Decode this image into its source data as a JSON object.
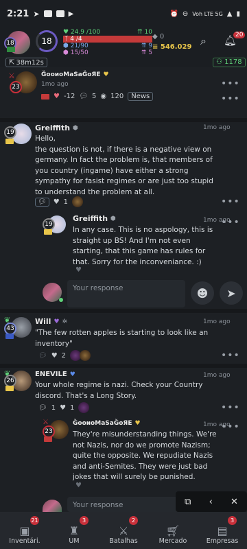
{
  "status_bar": {
    "time": "2:21",
    "network": "Voh LTE 5G"
  },
  "top_bar": {
    "level": "18",
    "avatar_level": "18",
    "energy": "24.9 /100",
    "energy_gain": "10",
    "health": "4 /4",
    "stat_a": "21/90",
    "stat_a_gain": "9",
    "stat_b": "15/50",
    "stat_b_gain": "5",
    "gold": "0",
    "money": "546.029",
    "notification_count": "20"
  },
  "sub_bar": {
    "timer": "38m12s",
    "online": "1178"
  },
  "top_post": {
    "username": "ĞooиoMaSaĞoЯE",
    "time": "1mo ago",
    "level": "23",
    "votes": "-12",
    "comments": "5",
    "views": "120",
    "category": "News"
  },
  "comments": [
    {
      "username": "Greiffith",
      "time": "1mo ago",
      "level": "19",
      "text": "Hello,\nthe question is not, if there is a negative view on germany. In fact the problem is, that members of you country (ingame) have either a strong sympathy for fasist regimes or are just too stupid to understand the problem at all.",
      "replies_count": "",
      "likes": "1",
      "reply": {
        "username": "Greiffith",
        "time": "1mo ago",
        "level": "19",
        "text": "In any case. This is no aspology, this is straight up BS! And I'm not even starting, that this game has rules for that.  Sorry for the inconveniance. :)"
      }
    },
    {
      "username": "Will",
      "time": "1mo ago",
      "level": "43",
      "text": "\"The few rotten apples is starting to look like an inventory\"",
      "likes": "2"
    },
    {
      "username": "ENEVILE",
      "time": "1mo ago",
      "level": "26",
      "text": "Your whole regime is nazi. Check your Country discord. That's a Long Story.",
      "likes": "1",
      "replies": "1",
      "reply": {
        "username": "ĞooиoMaSaĞoЯE",
        "time": "1mo ago",
        "level": "23",
        "text": "They're misunderstanding things. We're not Nazis, nor do we promote Nazism; quite the opposite. We repudiate Nazis and anti-Semites. They were just bad jokes that will surely be punished."
      }
    }
  ],
  "response": {
    "placeholder": "Your response"
  },
  "bottom_nav": [
    {
      "label": "Inventári.",
      "badge": "21"
    },
    {
      "label": "UM",
      "badge": "3"
    },
    {
      "label": "Batalhas",
      "badge": "2"
    },
    {
      "label": "Mercado",
      "badge": ""
    },
    {
      "label": "Empresas",
      "badge": "3"
    }
  ]
}
